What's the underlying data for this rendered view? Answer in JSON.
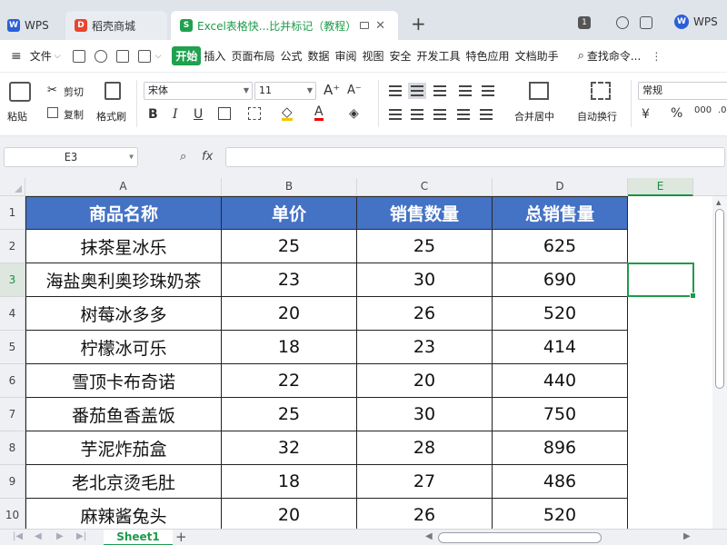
{
  "tabs": {
    "wps": "WPS",
    "store": "稻壳商城",
    "doc": "Excel表格快...比并标记（教程）",
    "right_brand": "WPS"
  },
  "menubar": {
    "file": "文件",
    "items": [
      "开始",
      "插入",
      "页面布局",
      "公式",
      "数据",
      "审阅",
      "视图",
      "安全",
      "开发工具",
      "特色应用",
      "文档助手"
    ],
    "search": "查找命令..."
  },
  "ribbon": {
    "paste": "粘贴",
    "cut": "剪切",
    "copy": "复制",
    "format_painter": "格式刷",
    "font_name": "宋体",
    "font_size": "11",
    "merge_center": "合并居中",
    "wrap_text": "自动换行",
    "number_format": "常规"
  },
  "formula_bar": {
    "name_box": "E3",
    "fx": "fx",
    "value": ""
  },
  "grid": {
    "columns": [
      "A",
      "B",
      "C",
      "D",
      "E"
    ],
    "selected_column": "E",
    "selected_row": "3",
    "headers": [
      "商品名称",
      "单价",
      "销售数量",
      "总销售量"
    ],
    "rows": [
      {
        "num": "2",
        "name": "抹茶星冰乐",
        "price": "25",
        "qty": "25",
        "total": "625"
      },
      {
        "num": "3",
        "name": "海盐奥利奥珍珠奶茶",
        "price": "23",
        "qty": "30",
        "total": "690"
      },
      {
        "num": "4",
        "name": "树莓冰多多",
        "price": "20",
        "qty": "26",
        "total": "520"
      },
      {
        "num": "5",
        "name": "柠檬冰可乐",
        "price": "18",
        "qty": "23",
        "total": "414"
      },
      {
        "num": "6",
        "name": "雪顶卡布奇诺",
        "price": "22",
        "qty": "20",
        "total": "440"
      },
      {
        "num": "7",
        "name": "番茄鱼香盖饭",
        "price": "25",
        "qty": "30",
        "total": "750"
      },
      {
        "num": "8",
        "name": "芋泥炸茄盒",
        "price": "32",
        "qty": "28",
        "total": "896"
      },
      {
        "num": "9",
        "name": "老北京烫毛肚",
        "price": "18",
        "qty": "27",
        "total": "486"
      },
      {
        "num": "10",
        "name": "麻辣酱兔头",
        "price": "20",
        "qty": "26",
        "total": "520"
      }
    ],
    "header_row_num": "1"
  },
  "sheets": {
    "active": "Sheet1",
    "add": "+"
  },
  "colors": {
    "accent_green": "#1fa14f",
    "header_blue": "#4472c4"
  }
}
